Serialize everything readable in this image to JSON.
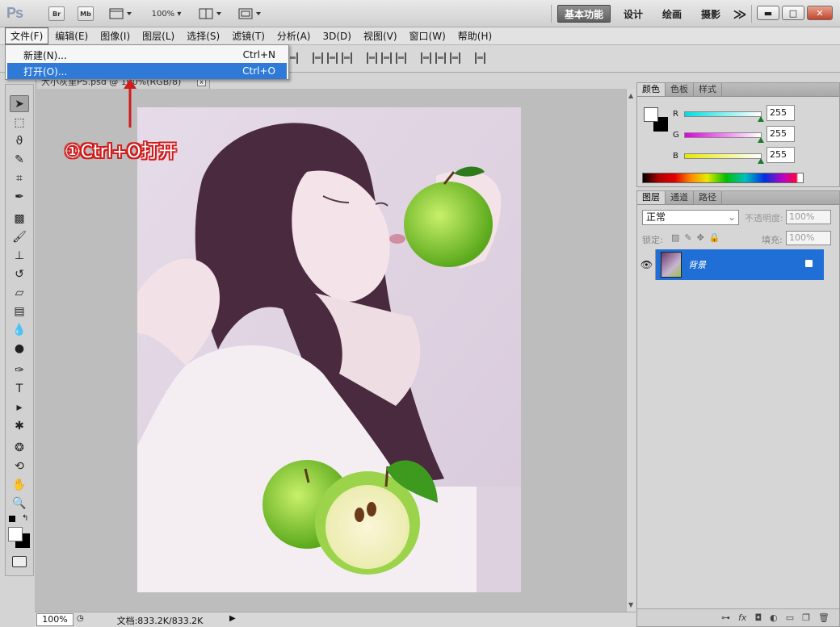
{
  "app": {
    "logo": "Ps",
    "bridge_label": "Br",
    "minibridge_label": "Mb",
    "zoom_level": "100%",
    "workspaces": [
      "基本功能",
      "设计",
      "绘画",
      "摄影"
    ],
    "more_label": "≫"
  },
  "menubar": [
    "文件(F)",
    "编辑(E)",
    "图像(I)",
    "图层(L)",
    "选择(S)",
    "滤镜(T)",
    "分析(A)",
    "3D(D)",
    "视图(V)",
    "窗口(W)",
    "帮助(H)"
  ],
  "file_menu": {
    "items": [
      {
        "label": "新建(N)...",
        "shortcut": "Ctrl+N"
      },
      {
        "label": "打开(O)...",
        "shortcut": "Ctrl+O"
      }
    ]
  },
  "document": {
    "tab_title": "大小灰里PS.psd @ 100%(RGB/8)",
    "close_label": "x"
  },
  "status": {
    "zoom": "100%",
    "doc_size": "文档:833.2K/833.2K"
  },
  "color_panel": {
    "tabs": [
      "颜色",
      "色板",
      "样式"
    ],
    "channels": [
      {
        "name": "R",
        "value": "255",
        "color": "#00d0d0"
      },
      {
        "name": "G",
        "value": "255",
        "color": "#d000d0"
      },
      {
        "name": "B",
        "value": "255",
        "color": "#e0e000"
      }
    ]
  },
  "layers_panel": {
    "tabs": [
      "图层",
      "通道",
      "路径"
    ],
    "blend_mode": "正常",
    "opacity_label": "不透明度:",
    "opacity_value": "100%",
    "lock_label": "锁定:",
    "fill_label": "填充:",
    "fill_value": "100%",
    "layers": [
      {
        "name": "背景"
      }
    ],
    "footer_icons": [
      "link-icon",
      "fx-icon",
      "mask-icon",
      "adjustment-icon",
      "folder-icon",
      "new-layer-icon",
      "trash-icon"
    ]
  },
  "annotation": {
    "text": "①Ctrl+O打开",
    "color": "#d21a1a"
  }
}
